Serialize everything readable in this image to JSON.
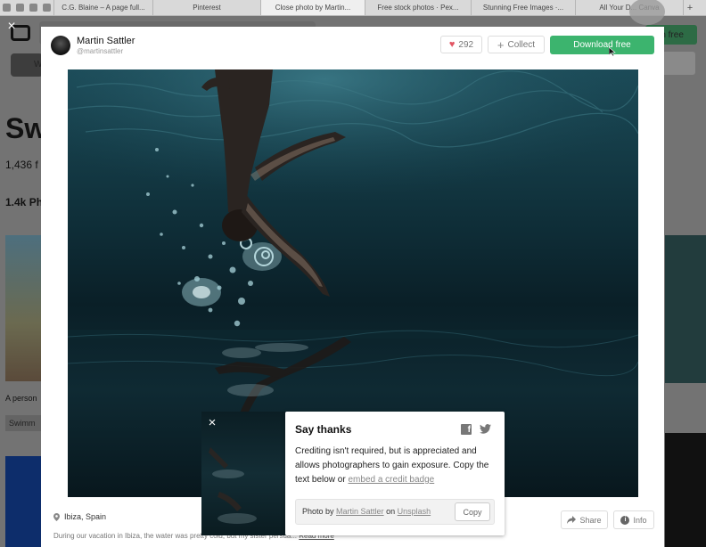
{
  "browser": {
    "tabs": [
      {
        "label": "C.G. Blaine – A page full..."
      },
      {
        "label": "Pinterest"
      },
      {
        "label": "Close photo by Martin...",
        "active": true
      },
      {
        "label": "Free stock photos · Pex..."
      },
      {
        "label": "Stunning Free Images ·..."
      },
      {
        "label": "All Your D... Canva"
      }
    ],
    "new_tab": "+"
  },
  "background_page": {
    "heading": "Sw",
    "count": "1,436 f",
    "photos_count": "1.4k Ph",
    "caption": "A person",
    "tag": "Swimm",
    "join_button": "in free",
    "menu_pill": "W"
  },
  "modal": {
    "close_icon": "×",
    "author": {
      "name": "Martin Sattler",
      "handle": "@martinsattler"
    },
    "like": {
      "count": "292"
    },
    "collect_label": "Collect",
    "download_label": "Download free",
    "location": "Ibiza, Spain",
    "description": "During our vacation in Ibiza, the water was pretty cold, but my sister persua...",
    "read_more": "Read more",
    "share_label": "Share",
    "info_label": "Info"
  },
  "say_thanks": {
    "title": "Say thanks",
    "body_text": "Crediting isn't required, but is appreciated and allows photographers to gain exposure. Copy the text below or",
    "embed_link": "embed a credit badge",
    "credit_prefix": "Photo by",
    "credit_author": "Martin Sattler",
    "credit_on": "on",
    "credit_site": "Unsplash",
    "copy_label": "Copy",
    "close_icon": "×"
  },
  "colors": {
    "download_green": "#3cb46e",
    "heart_red": "#e25563",
    "overlay": "#737373",
    "water_dark": "#0a1d24"
  }
}
